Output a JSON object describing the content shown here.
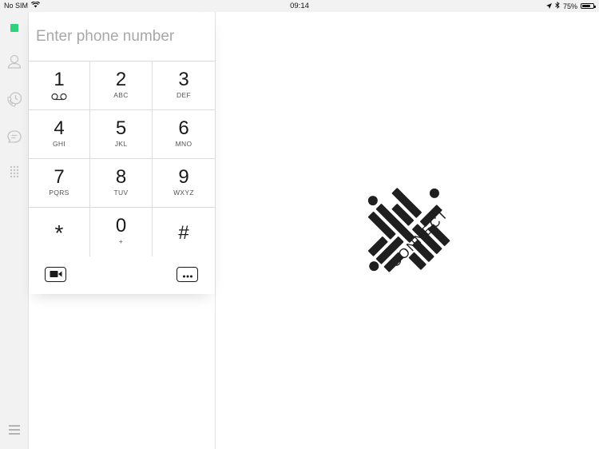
{
  "statusbar": {
    "carrier": "No SIM",
    "time": "09:14",
    "battery_text": "75%",
    "battery_level": 0.75
  },
  "sidebar": {
    "items": [
      {
        "icon": "presence-status-icon",
        "color": "#2fd27a"
      },
      {
        "icon": "contacts-icon"
      },
      {
        "icon": "call-history-icon"
      },
      {
        "icon": "messages-icon"
      },
      {
        "icon": "dialpad-icon"
      },
      {
        "icon": "menu-icon"
      }
    ]
  },
  "dialer": {
    "placeholder": "Enter phone number",
    "keys": [
      {
        "digit": "1",
        "letters": "",
        "icon": "voicemail-icon"
      },
      {
        "digit": "2",
        "letters": "ABC"
      },
      {
        "digit": "3",
        "letters": "DEF"
      },
      {
        "digit": "4",
        "letters": "GHI"
      },
      {
        "digit": "5",
        "letters": "JKL"
      },
      {
        "digit": "6",
        "letters": "MNO"
      },
      {
        "digit": "7",
        "letters": "PQRS"
      },
      {
        "digit": "8",
        "letters": "TUV"
      },
      {
        "digit": "9",
        "letters": "WXYZ"
      },
      {
        "digit": "*",
        "letters": ""
      },
      {
        "digit": "0",
        "letters": "+"
      },
      {
        "digit": "#",
        "letters": ""
      }
    ],
    "video_icon": "video-call-icon",
    "more_icon": "more-options-icon"
  },
  "logo": {
    "text": "CONNECT",
    "color": "#1f1f1f"
  }
}
